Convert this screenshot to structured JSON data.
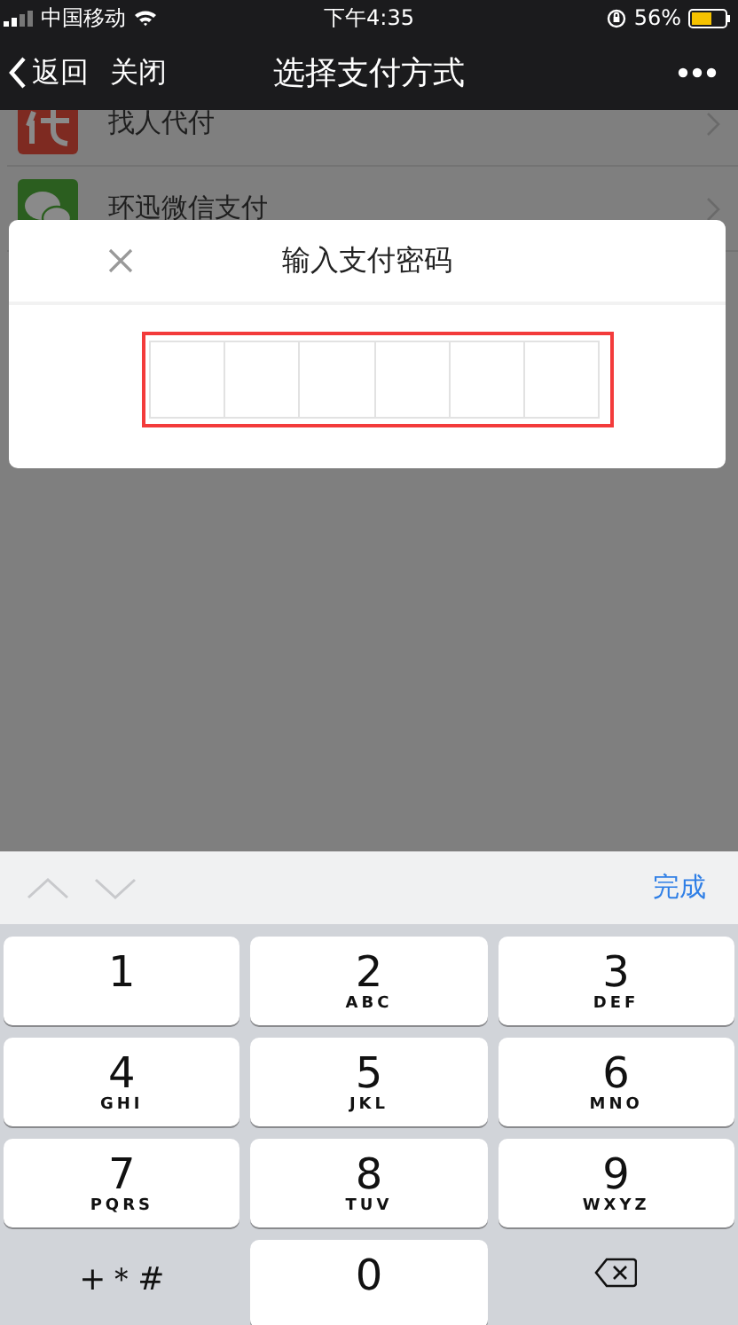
{
  "status_bar": {
    "carrier": "中国移动",
    "time": "下午4:35",
    "battery": "56%"
  },
  "nav": {
    "back": "返回",
    "close": "关闭",
    "title": "选择支付方式"
  },
  "payment_methods": [
    {
      "name": "找人代付",
      "kind": "proxy"
    },
    {
      "name": "环迅微信支付",
      "kind": "wechat"
    }
  ],
  "dialog": {
    "title": "输入支付密码"
  },
  "keyboard": {
    "done": "完成",
    "keys": [
      {
        "kind": "digit",
        "digit": "1"
      },
      {
        "kind": "digit",
        "digit": "2",
        "letters": "ABC"
      },
      {
        "kind": "digit",
        "digit": "3",
        "letters": "DEF"
      },
      {
        "kind": "digit",
        "digit": "4",
        "letters": "GHI"
      },
      {
        "kind": "digit",
        "digit": "5",
        "letters": "JKL"
      },
      {
        "kind": "digit",
        "digit": "6",
        "letters": "MNO"
      },
      {
        "kind": "digit",
        "digit": "7",
        "letters": "PQRS"
      },
      {
        "kind": "digit",
        "digit": "8",
        "letters": "TUV"
      },
      {
        "kind": "digit",
        "digit": "9",
        "letters": "WXYZ"
      },
      {
        "kind": "symbols",
        "label": "+＊#"
      },
      {
        "kind": "digit",
        "digit": "0"
      },
      {
        "kind": "delete"
      }
    ]
  }
}
